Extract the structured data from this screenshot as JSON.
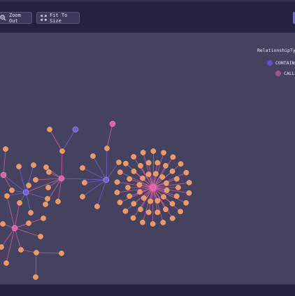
{
  "toolbar": {
    "zoom_out_label": "Zoom Out",
    "fit_label": "Fit To Size"
  },
  "legend": {
    "title": "RelationshipTyp",
    "items": [
      {
        "label": "CONTAINS",
        "color": "#5c52c9"
      },
      {
        "label": "CALLS",
        "color": "#a8528e"
      }
    ]
  },
  "colors": {
    "background": "#44425f",
    "toolbar": "#232240",
    "leaf_node": "#f4965f",
    "contains_node": "#6a5fe3",
    "calls_node": "#e15fab",
    "contains_edge": "#7068d8",
    "calls_edge": "#d8609f"
  }
}
